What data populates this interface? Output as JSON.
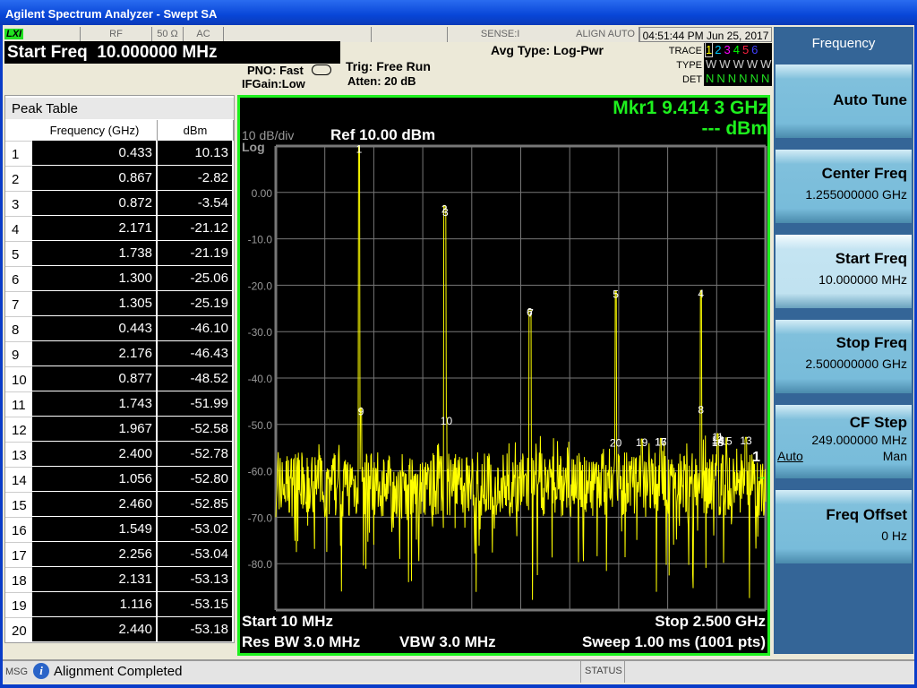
{
  "window": {
    "title": "Agilent Spectrum Analyzer - Swept SA"
  },
  "status_bar": {
    "lxi": "LXI",
    "rf": "RF",
    "impedance": "50 Ω",
    "coupling": "AC",
    "sense": "SENSE:INT",
    "align": "ALIGN AUTO",
    "time": "04:51:44 PM",
    "date": "Jun 25, 2017"
  },
  "active_function": {
    "label": "Start Freq",
    "value": "10.000000 MHz"
  },
  "settings": {
    "pno": "PNO: Fast",
    "ifgain": "IFGain:Low",
    "trig": "Trig: Free Run",
    "atten": "Atten: 20 dB",
    "avg_type": "Avg Type: Log-Pwr"
  },
  "trace_info": {
    "trace_label": "TRACE",
    "type_label": "TYPE",
    "det_label": "DET",
    "traces": [
      "1",
      "2",
      "3",
      "4",
      "5",
      "6"
    ],
    "trace_colors": [
      "#ffff00",
      "#00c8ff",
      "#ff00ff",
      "#00ff00",
      "#ff2040",
      "#4040ff"
    ],
    "types": [
      "W",
      "W",
      "W",
      "W",
      "W",
      "W"
    ],
    "dets": [
      "N",
      "N",
      "N",
      "N",
      "N",
      "N"
    ]
  },
  "peak_table": {
    "title": "Peak Table",
    "columns": [
      "Frequency (GHz)",
      "dBm"
    ],
    "rows": [
      [
        "1",
        "0.433",
        "10.13"
      ],
      [
        "2",
        "0.867",
        "-2.82"
      ],
      [
        "3",
        "0.872",
        "-3.54"
      ],
      [
        "4",
        "2.171",
        "-21.12"
      ],
      [
        "5",
        "1.738",
        "-21.19"
      ],
      [
        "6",
        "1.300",
        "-25.06"
      ],
      [
        "7",
        "1.305",
        "-25.19"
      ],
      [
        "8",
        "0.443",
        "-46.10"
      ],
      [
        "9",
        "2.176",
        "-46.43"
      ],
      [
        "10",
        "0.877",
        "-48.52"
      ],
      [
        "11",
        "1.743",
        "-51.99"
      ],
      [
        "12",
        "1.967",
        "-52.58"
      ],
      [
        "13",
        "2.400",
        "-52.78"
      ],
      [
        "14",
        "1.056",
        "-52.80"
      ],
      [
        "15",
        "2.460",
        "-52.85"
      ],
      [
        "16",
        "1.549",
        "-53.02"
      ],
      [
        "17",
        "2.256",
        "-53.04"
      ],
      [
        "18",
        "2.131",
        "-53.13"
      ],
      [
        "19",
        "1.116",
        "-53.15"
      ],
      [
        "20",
        "2.440",
        "-53.18"
      ]
    ]
  },
  "graph": {
    "scale": "10 dB/div",
    "scale_type": "Log",
    "ref": "Ref 10.00 dBm",
    "marker_freq": "Mkr1 9.414 3 GHz",
    "marker_amp": "--- dBm",
    "start": "Start 10 MHz",
    "stop": "Stop 2.500 GHz",
    "rbw": "Res BW 3.0 MHz",
    "vbw": "VBW 3.0 MHz",
    "sweep": "Sweep  1.00 ms (1001 pts)",
    "trace_number": "1"
  },
  "chart_data": {
    "type": "line",
    "xlabel": "",
    "ylabel": "",
    "xlim": [
      0.01,
      2.5
    ],
    "ylim": [
      -90,
      10
    ],
    "x_unit": "GHz",
    "y_unit": "dBm",
    "grid": true,
    "trace_color": "#ffff00",
    "yticks": [
      "0.00",
      "-10.0",
      "-20.0",
      "-30.0",
      "-40.0",
      "-50.0",
      "-60.0",
      "-70.0",
      "-80.0"
    ],
    "markers": [
      [
        1,
        0.433,
        10.13
      ],
      [
        2,
        0.867,
        -2.82
      ],
      [
        3,
        0.872,
        -3.54
      ],
      [
        4,
        2.171,
        -21.12
      ],
      [
        5,
        1.738,
        -21.19
      ],
      [
        6,
        1.3,
        -25.06
      ],
      [
        7,
        1.305,
        -25.19
      ],
      [
        8,
        2.171,
        -46.1
      ],
      [
        9,
        0.443,
        -46.43
      ],
      [
        10,
        0.877,
        -48.52
      ],
      [
        11,
        2.256,
        -51.99
      ],
      [
        12,
        2.256,
        -52.58
      ],
      [
        13,
        2.4,
        -52.78
      ],
      [
        14,
        2.256,
        -52.8
      ],
      [
        15,
        2.3,
        -52.85
      ],
      [
        16,
        1.967,
        -53.02
      ],
      [
        17,
        1.967,
        -53.04
      ],
      [
        18,
        2.256,
        -53.13
      ],
      [
        19,
        1.87,
        -53.15
      ],
      [
        20,
        1.738,
        -53.18
      ]
    ]
  },
  "softkeys": {
    "title": "Frequency",
    "items": [
      {
        "label": "Auto Tune",
        "value": ""
      },
      {
        "label": "Center Freq",
        "value": "1.255000000 GHz"
      },
      {
        "label": "Start Freq",
        "value": "10.000000 MHz"
      },
      {
        "label": "Stop Freq",
        "value": "2.500000000 GHz"
      },
      {
        "label": "CF Step",
        "value": "249.000000 MHz",
        "auto": "Auto",
        "man": "Man"
      },
      {
        "label": "Freq Offset",
        "value": "0 Hz"
      }
    ]
  },
  "message_bar": {
    "msg": "MSG",
    "text": "Alignment Completed",
    "status": "STATUS"
  }
}
